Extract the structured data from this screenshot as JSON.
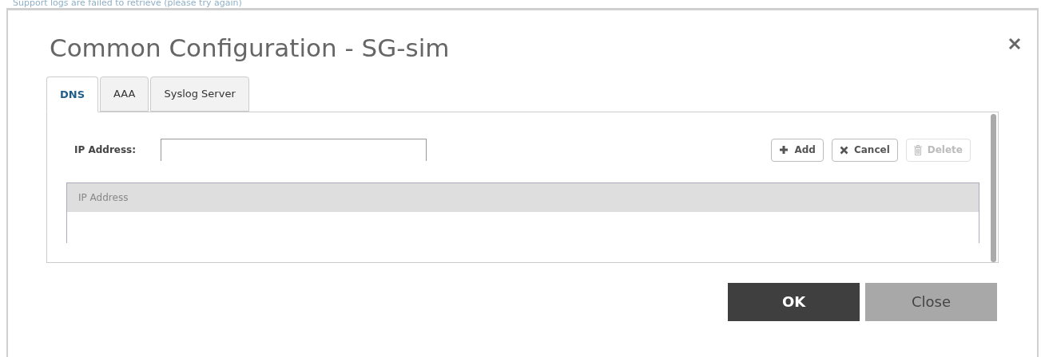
{
  "background_message": "Support logs are failed to retrieve (please try again)",
  "dialog": {
    "title": "Common Configuration - SG-sim"
  },
  "tabs": [
    {
      "label": "DNS",
      "selected": true
    },
    {
      "label": "AAA",
      "selected": false
    },
    {
      "label": "Syslog Server",
      "selected": false
    }
  ],
  "form": {
    "label": "IP Address:"
  },
  "actions": [
    {
      "kind": "add",
      "label": "Add",
      "disabled": false
    },
    {
      "kind": "cancel",
      "label": "Cancel",
      "disabled": false
    },
    {
      "kind": "delete",
      "label": "Delete",
      "disabled": true
    }
  ],
  "table": {
    "columns": [
      "IP Address"
    ]
  },
  "footer_buttons": [
    {
      "kind": "primary",
      "label": "OK"
    },
    {
      "kind": "secondary",
      "label": "Close"
    }
  ]
}
